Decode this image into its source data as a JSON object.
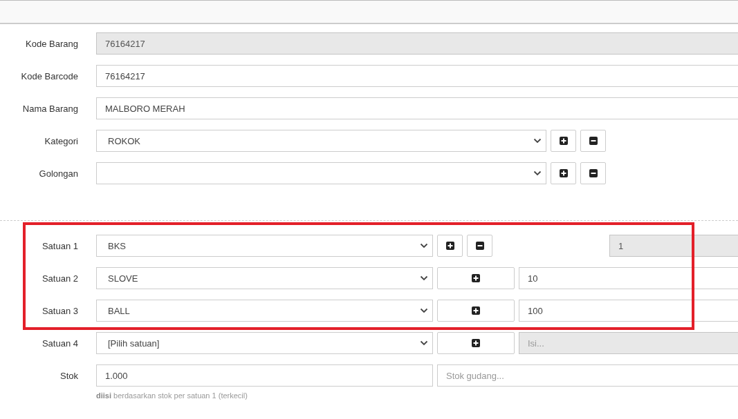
{
  "fields": [
    {
      "label": "Kode Barang",
      "kind": "text",
      "value": "76164217",
      "disabled": true
    },
    {
      "label": "Kode Barcode",
      "kind": "text",
      "value": "76164217",
      "disabled": false
    },
    {
      "label": "Nama Barang",
      "kind": "text",
      "value": "MALBORO MERAH",
      "disabled": false
    },
    {
      "label": "Kategori",
      "kind": "select",
      "value": "ROKOK",
      "disabled": false
    },
    {
      "label": "Golongan",
      "kind": "select",
      "disabled": false
    }
  ],
  "units": [
    {
      "label": "Satuan 1",
      "kind": "base",
      "value": "BKS",
      "quantity": "1",
      "quantity_disabled": true
    },
    {
      "label": "Satuan 2",
      "kind": "conversion",
      "value": "SLOVE",
      "quantity": "10",
      "quantity_disabled": false
    },
    {
      "label": "Satuan 3",
      "kind": "conversion",
      "value": "BALL",
      "quantity": "100",
      "quantity_disabled": false
    },
    {
      "label": "Satuan 4",
      "kind": "conversion",
      "value": "[Pilih satuan]",
      "placeholder": "Isi...",
      "quantity_disabled": true
    }
  ],
  "stock": {
    "label": "Stok",
    "value": "1.000",
    "warehouse_placeholder": "Stok gudang...",
    "help": "**diisi** berdasarkan stok per satuan 1 (terkecil)"
  }
}
